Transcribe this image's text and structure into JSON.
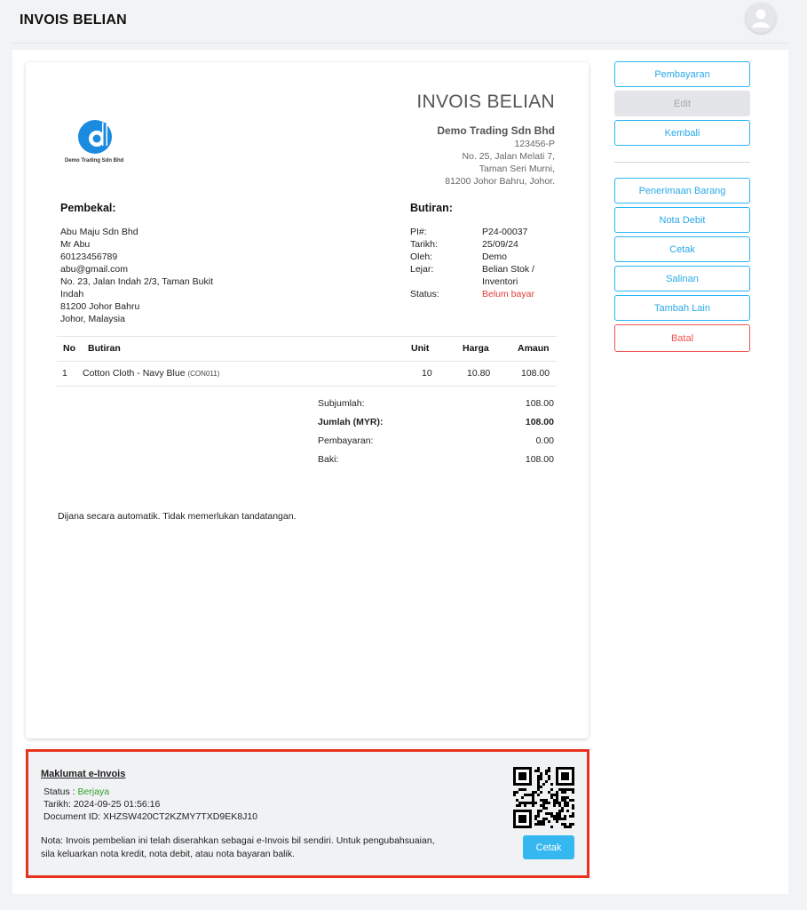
{
  "header": {
    "title": "INVOIS BELIAN"
  },
  "invoice": {
    "title": "INVOIS BELIAN",
    "logo_text": "Demo Trading Sdn Bhd",
    "company": {
      "name": "Demo Trading Sdn Bhd",
      "reg_no": "123456-P",
      "address": [
        "No. 25, Jalan Melati 7,",
        "Taman Seri Murni,",
        "81200 Johor Bahru, Johor."
      ]
    },
    "supplier": {
      "heading": "Pembekal:",
      "lines": [
        "Abu Maju Sdn Bhd",
        "Mr Abu",
        "60123456789",
        "abu@gmail.com",
        "No. 23, Jalan Indah 2/3, Taman Bukit",
        "Indah",
        "81200 Johor Bahru",
        "Johor, Malaysia"
      ]
    },
    "details": {
      "heading": "Butiran:",
      "labels": {
        "pi": "PI#:",
        "date": "Tarikh:",
        "by": "Oleh:",
        "ledger": "Lejar:",
        "status": "Status:"
      },
      "values": {
        "pi": "P24-00037",
        "date": "25/09/24",
        "by": "Demo",
        "ledger_1": "Belian Stok /",
        "ledger_2": "Inventori",
        "status": "Belum bayar"
      }
    },
    "table": {
      "headers": {
        "no": "No",
        "item": "Butiran",
        "unit": "Unit",
        "price": "Harga",
        "amount": "Amaun"
      },
      "rows": [
        {
          "no": "1",
          "item": "Cotton Cloth - Navy Blue",
          "code": "(CON011)",
          "unit": "10",
          "price": "10.80",
          "amount": "108.00"
        }
      ]
    },
    "summary": {
      "subtotal_label": "Subjumlah:",
      "subtotal": "108.00",
      "total_label": "Jumlah (MYR):",
      "total": "108.00",
      "payment_label": "Pembayaran:",
      "payment": "0.00",
      "balance_label": "Baki:",
      "balance": "108.00"
    },
    "footer_note": "Dijana secara automatik. Tidak memerlukan tandatangan."
  },
  "sidebar": {
    "pembayaran": "Pembayaran",
    "edit": "Edit",
    "kembali": "Kembali",
    "penerimaan": "Penerimaan Barang",
    "nota_debit": "Nota Debit",
    "cetak": "Cetak",
    "salinan": "Salinan",
    "tambah_lain": "Tambah Lain",
    "batal": "Batal"
  },
  "einvoice": {
    "heading": "Maklumat e-Invois",
    "status_label": "Status : ",
    "status_value": "Berjaya",
    "date_line": "Tarikh: 2024-09-25 01:56:16",
    "doc_line": "Document ID: XHZSW420CT2KZMY7TXD9EK8J10",
    "note_1": "Nota: Invois pembelian ini telah diserahkan sebagai e-Invois bil sendiri. Untuk pengubahsuaian,",
    "note_2": "sila keluarkan nota kredit, nota debit, atau nota bayaran balik.",
    "print_button": "Cetak"
  },
  "colors": {
    "accent": "#29b6f6",
    "danger": "#ef5350",
    "success": "#2e9e2e",
    "highlight_border": "#e8321e"
  },
  "icons": {
    "avatar": "user-avatar-icon",
    "logo": "company-logo-icon",
    "qr": "qr-code-icon"
  }
}
